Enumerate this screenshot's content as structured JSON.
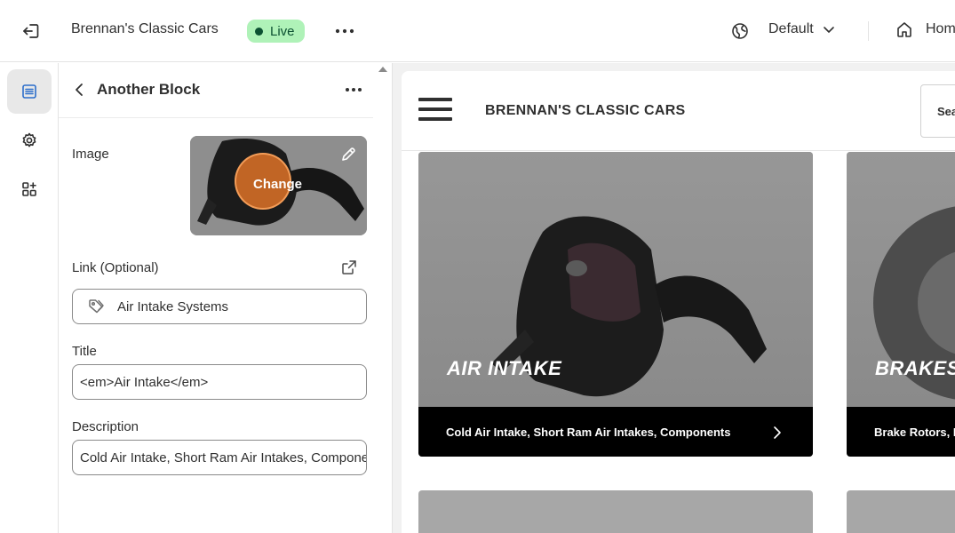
{
  "topbar": {
    "store_name": "Brennan's Classic Cars",
    "status_badge": "Live",
    "theme_select": "Default",
    "home_label": "Home",
    "icons": [
      "exit-icon",
      "more-horizontal-icon",
      "globe-icon",
      "chevron-down-icon",
      "home-icon"
    ]
  },
  "rail": {
    "items": [
      {
        "name": "sections",
        "icon": "sections-icon",
        "active": true
      },
      {
        "name": "theme-settings",
        "icon": "gear-icon",
        "active": false
      },
      {
        "name": "app-embeds",
        "icon": "apps-icon",
        "active": false
      }
    ]
  },
  "panel": {
    "title": "Another Block",
    "image_label": "Image",
    "image_change_label": "Change",
    "link_label": "Link (Optional)",
    "link_value": "Air Intake Systems",
    "title_label": "Title",
    "title_value": "<em>Air Intake</em>",
    "description_label": "Description",
    "description_value": "Cold Air Intake, Short Ram Air Intakes, Components"
  },
  "preview": {
    "store_logo": "BRENNAN'S CLASSIC CARS",
    "search_label": "Sea",
    "cards": [
      {
        "title": "AIR INTAKE",
        "footer": "Cold Air Intake, Short Ram Air Intakes, Components"
      },
      {
        "title": "BRAKES",
        "footer": "Brake Rotors, P"
      }
    ]
  },
  "colors": {
    "live_badge_bg": "#aff2b8",
    "live_badge_text": "#0c5132",
    "card_footer_bg": "#000000",
    "preview_bg": "#f1f1f1"
  }
}
